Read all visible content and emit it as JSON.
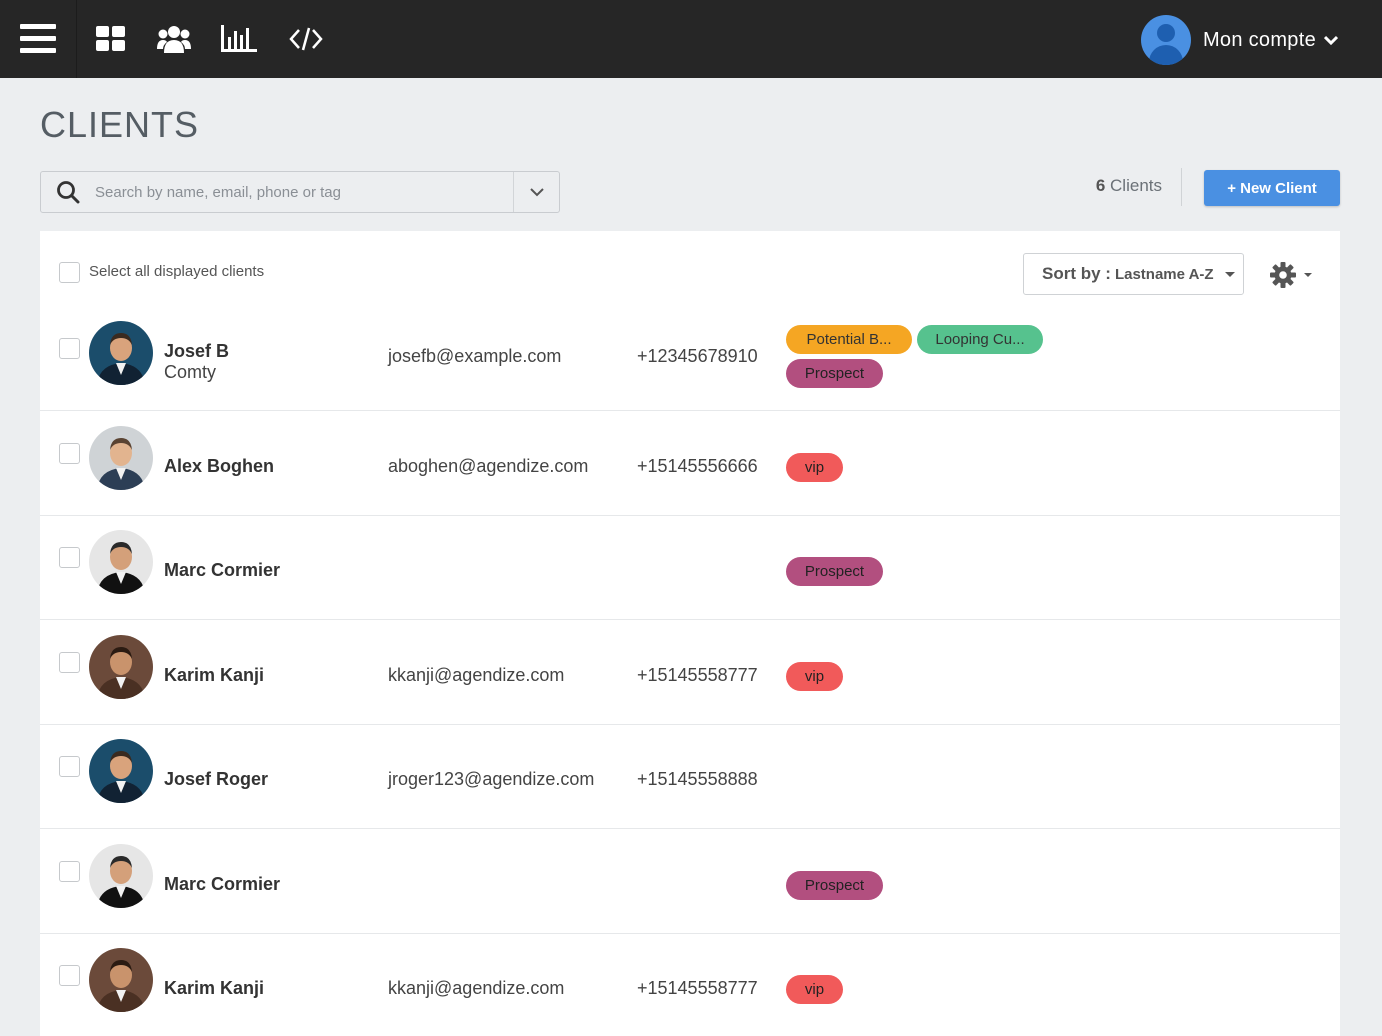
{
  "header": {
    "menu_icon": "hamburger-icon",
    "nav_icons": [
      "dashboard-grid-icon",
      "users-group-icon",
      "bar-chart-icon",
      "code-icon"
    ],
    "account_label": "Mon compte"
  },
  "page": {
    "title": "CLIENTS"
  },
  "search": {
    "placeholder": "Search by name, email, phone or tag",
    "value": ""
  },
  "toolbar": {
    "count_number": "6",
    "count_label": "Clients",
    "new_client_label": "+ New Client"
  },
  "list": {
    "select_all_label": "Select all displayed clients",
    "sort_label": "Sort by :",
    "sort_value": "Lastname A-Z",
    "settings_icon": "gear-icon"
  },
  "colors": {
    "topbar": "#262626",
    "accent": "#4a90e2",
    "tag_orange": "#f5a623",
    "tag_green": "#56c28e",
    "tag_purple": "#b24f7f",
    "tag_red": "#f15a5a"
  },
  "clients": [
    {
      "name": "Josef B",
      "company": "Comty",
      "email": "josefb@example.com",
      "phone": "+12345678910",
      "tags": [
        {
          "label": "Potential B...",
          "color": "orange"
        },
        {
          "label": "Looping Cu...",
          "color": "green"
        },
        {
          "label": "Prospect",
          "color": "purple"
        }
      ]
    },
    {
      "name": "Alex Boghen",
      "company": "",
      "email": "aboghen@agendize.com",
      "phone": "+15145556666",
      "tags": [
        {
          "label": "vip",
          "color": "red"
        }
      ]
    },
    {
      "name": "Marc Cormier",
      "company": "",
      "email": "",
      "phone": "",
      "tags": [
        {
          "label": "Prospect",
          "color": "purple"
        }
      ]
    },
    {
      "name": "Karim Kanji",
      "company": "",
      "email": "kkanji@agendize.com",
      "phone": "+15145558777",
      "tags": [
        {
          "label": "vip",
          "color": "red"
        }
      ]
    },
    {
      "name": "Josef Roger",
      "company": "",
      "email": "jroger123@agendize.com",
      "phone": "+15145558888",
      "tags": []
    },
    {
      "name": "Marc Cormier",
      "company": "",
      "email": "",
      "phone": "",
      "tags": [
        {
          "label": "Prospect",
          "color": "purple"
        }
      ]
    },
    {
      "name": "Karim Kanji",
      "company": "",
      "email": "kkanji@agendize.com",
      "phone": "+15145558777",
      "tags": [
        {
          "label": "vip",
          "color": "red"
        }
      ]
    }
  ]
}
